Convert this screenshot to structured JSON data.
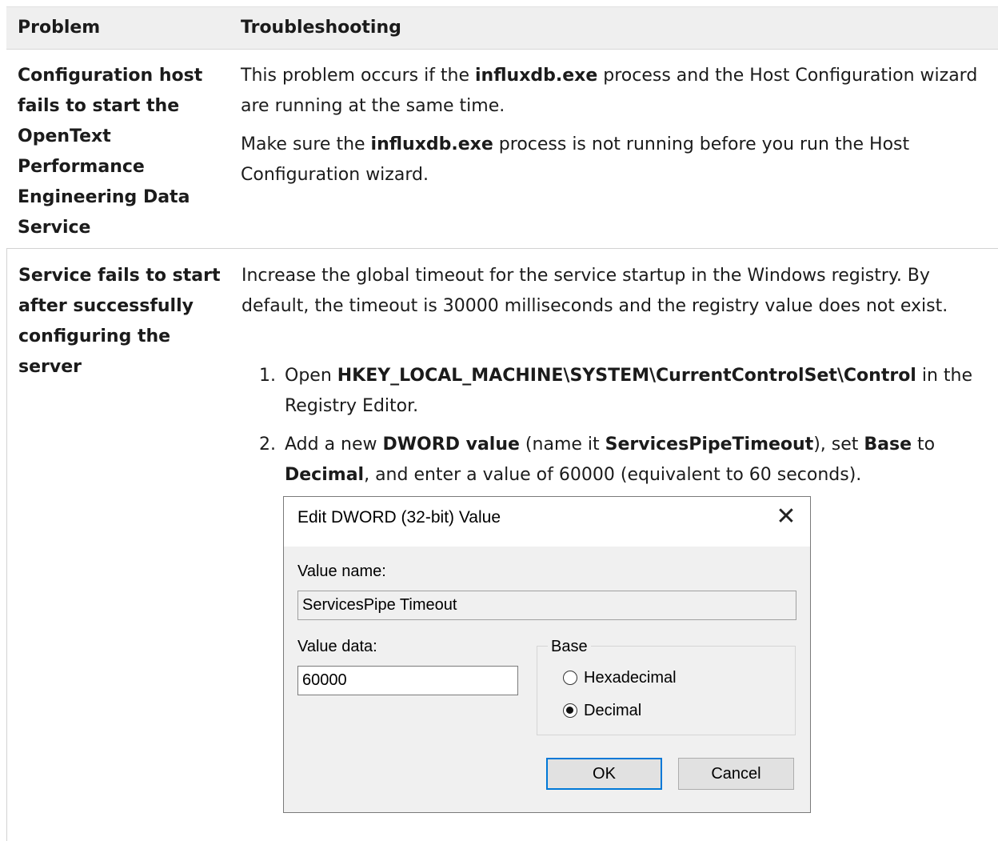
{
  "header": {
    "problem": "Problem",
    "troubleshooting": "Troubleshooting"
  },
  "row1": {
    "problem": "Configuration host fails to start the OpenText Performance Engineering Data Service",
    "p1": {
      "pre": "This problem occurs if the ",
      "bold": "influxdb.exe",
      "post": " process and the Host Configuration wizard are running at the same time."
    },
    "p2": {
      "pre": "Make sure the ",
      "bold": "influxdb.exe",
      "post": " process is not running before you run the Host Configuration wizard."
    }
  },
  "row2": {
    "problem": "Service fails to start after successfully configuring the server",
    "intro": "Increase the global timeout for the service startup in the Windows registry. By default, the timeout is 30000 milliseconds and the registry value does not exist.",
    "step1": {
      "num": "1.",
      "pre": "Open ",
      "bold": "HKEY_LOCAL_MACHINE\\SYSTEM\\CurrentControlSet\\Control",
      "post": " in the Registry Editor."
    },
    "step2": {
      "num": "2.",
      "t1": "Add a new ",
      "b1": "DWORD value",
      "t2": " (name it ",
      "b2": "ServicesPipeTimeout",
      "t3": "), set ",
      "b3": "Base",
      "t4": " to ",
      "b4": "Decimal",
      "t5": ", and enter a value of 60000 (equivalent to 60 seconds)."
    }
  },
  "dialog": {
    "title": "Edit DWORD (32-bit) Value",
    "close_glyph": "✕",
    "value_name_label": "Value name:",
    "value_name": "ServicesPipe Timeout",
    "value_data_label": "Value data:",
    "value_data": "60000",
    "base_label": "Base",
    "radio_hex": "Hexadecimal",
    "radio_dec": "Decimal",
    "selected_base": "Decimal",
    "ok": "OK",
    "cancel": "Cancel",
    "accent_color": "#0078d7"
  }
}
